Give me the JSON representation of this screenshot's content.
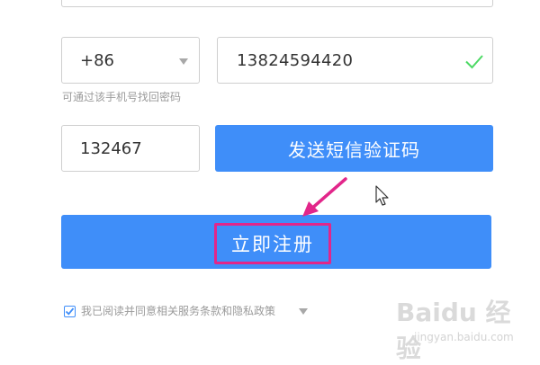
{
  "form": {
    "country_code": "+86",
    "phone_number": "13824594420",
    "phone_hint": "可通过该手机号找回密码",
    "verification_code": "132467",
    "send_code_label": "发送短信验证码",
    "register_label": "立即注册",
    "agreement_text": "我已阅读并同意相关服务条款和隐私政策",
    "agreement_checked": true
  },
  "icons": {
    "dropdown": "caret-down-icon",
    "valid": "check-icon",
    "pointer": "mouse-cursor-icon",
    "annotation": "arrow-icon"
  },
  "colors": {
    "primary": "#3f8ef9",
    "annotation": "#e2268a",
    "valid": "#4cd964",
    "hint_text": "#9a9a9a",
    "border": "#cfcfcf"
  },
  "watermark": {
    "brand": "Baidu 经验",
    "url": "jingyan.baidu.com"
  }
}
